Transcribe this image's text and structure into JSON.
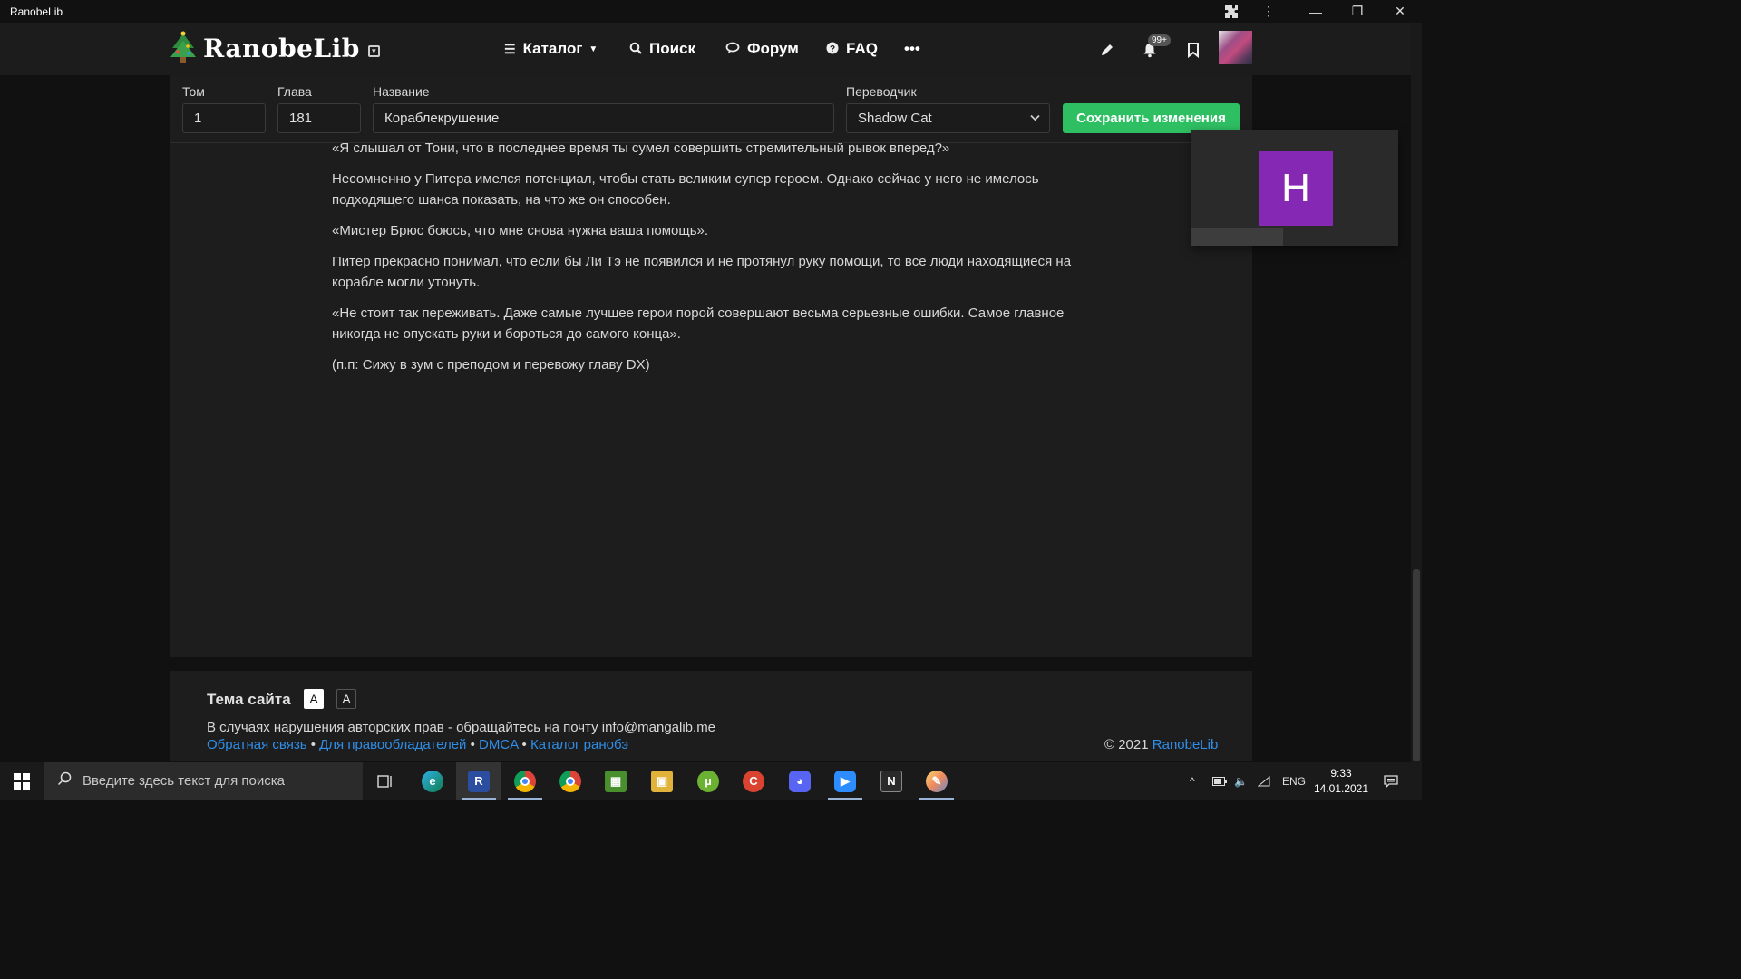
{
  "window": {
    "title": "RanobeLib"
  },
  "header": {
    "logo_text": "RanobeLib",
    "nav": [
      {
        "label": "Каталог",
        "icon": "menu-icon"
      },
      {
        "label": "Поиск",
        "icon": "search-icon"
      },
      {
        "label": "Форум",
        "icon": "chat-icon"
      },
      {
        "label": "FAQ",
        "icon": "help-icon"
      },
      {
        "label": "•••",
        "icon": "more-icon"
      }
    ],
    "notifications_badge": "99+"
  },
  "editor": {
    "volume_label": "Том",
    "volume_value": "1",
    "chapter_label": "Глава",
    "chapter_value": "181",
    "title_label": "Название",
    "title_value": "Кораблекрушение",
    "translator_label": "Переводчик",
    "translator_value": "Shadow Cat",
    "save_label": "Сохранить изменения"
  },
  "content": {
    "paragraphs": [
      "«Я слышал от Тони, что в последнее время ты сумел совершить стремительный рывок вперед?»",
      "Несомненно у Питера имелся потенциал, чтобы стать великим супер героем. Однако сейчас у него не имелось подходящего шанса показать, на что же он способен.",
      "«Мистер Брюс боюсь, что мне снова нужна ваша помощь».",
      "Питер прекрасно понимал, что если бы Ли Тэ не появился и не протянул руку помощи, то все люди находящиеся на корабле могли утонуть.",
      "«Не стоит так переживать. Даже самые лучшее герои порой совершают весьма серьезные ошибки. Самое главное никогда не опускать руки и бороться до самого конца».",
      "(п.п: Сижу в зум с преподом и перевожу главу DX)"
    ]
  },
  "popup": {
    "avatar_letter": "H",
    "avatar_color": "#8529b5"
  },
  "footer": {
    "theme_label": "Тема сайта",
    "theme_light": "A",
    "theme_dark": "A",
    "copyright_notice": "В случаях нарушения авторских прав - обращайтесь на почту info@mangalib.me",
    "links": [
      "Обратная связь",
      "Для правообладателей",
      "DMCA",
      "Каталог ранобэ"
    ],
    "separator": "•",
    "copyright_prefix": "© 2021",
    "copyright_link": "RanobeLib"
  },
  "taskbar": {
    "search_placeholder": "Введите здесь текст для поиска",
    "language": "ENG",
    "time": "9:33",
    "date": "14.01.2021"
  },
  "colors": {
    "accent_green": "#2fbf63",
    "link_blue": "#2f8ee8"
  }
}
